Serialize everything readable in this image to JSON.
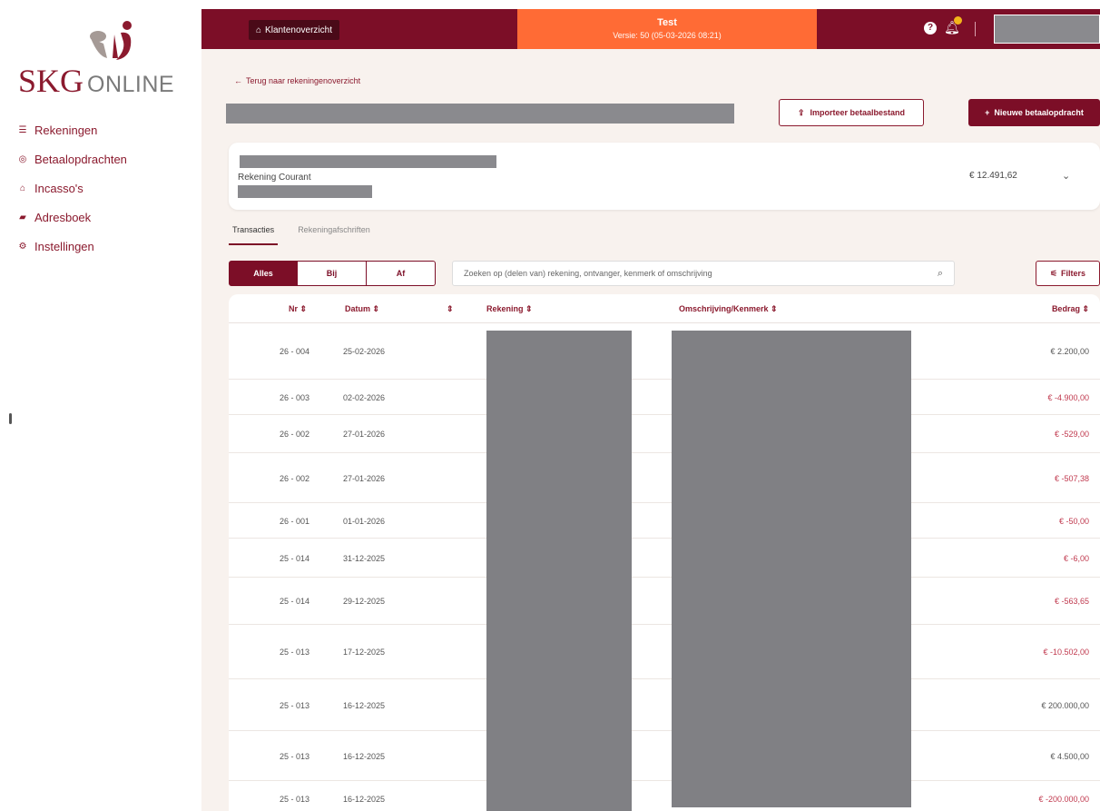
{
  "brand": {
    "name": "SKG",
    "suffix": "ONLINE",
    "color": "#8b1a2e"
  },
  "sidebar": {
    "items": [
      {
        "label": "Rekeningen",
        "icon": "list-icon"
      },
      {
        "label": "Betaalopdrachten",
        "icon": "circle-icon"
      },
      {
        "label": "Incasso's",
        "icon": "inbox-icon"
      },
      {
        "label": "Adresboek",
        "icon": "book-icon"
      },
      {
        "label": "Instellingen",
        "icon": "gears-icon"
      }
    ]
  },
  "topbar": {
    "klanten_label": "Klantenoverzicht",
    "env_title": "Test",
    "env_version": "Versie: 50 (05-03-2026 08:21)",
    "bg_color": "#7c0e27",
    "env_color": "#ff6b35"
  },
  "page": {
    "back_label": "Terug naar rekeningenoverzicht",
    "import_label": "Importeer betaalbestand",
    "new_label": "Nieuwe betaalopdracht"
  },
  "account": {
    "type": "Rekening Courant",
    "balance": "€ 12.491,62"
  },
  "tabs": [
    "Transacties",
    "Rekeningafschriften"
  ],
  "filters": {
    "options": [
      "Alles",
      "Bij",
      "Af"
    ],
    "search_placeholder": "Zoeken op (delen van) rekening, ontvanger, kenmerk of omschrijving",
    "filters_label": "Filters"
  },
  "table": {
    "headers": {
      "nr": "Nr ⇕",
      "datum": "Datum ⇕",
      "extra": "⇕",
      "rekening": "Rekening ⇕",
      "omschrijving": "Omschrijving/Kenmerk ⇕",
      "bedrag": "Bedrag ⇕"
    },
    "rows": [
      {
        "nr": "26 - 004",
        "datum": "25-02-2026",
        "bedrag": "€ 2.200,00"
      },
      {
        "nr": "26 - 003",
        "datum": "02-02-2026",
        "bedrag": "€ -4.900,00"
      },
      {
        "nr": "26 - 002",
        "datum": "27-01-2026",
        "bedrag": "€ -529,00"
      },
      {
        "nr": "26 - 002",
        "datum": "27-01-2026",
        "bedrag": "€ -507,38"
      },
      {
        "nr": "26 - 001",
        "datum": "01-01-2026",
        "bedrag": "€ -50,00"
      },
      {
        "nr": "25 - 014",
        "datum": "31-12-2025",
        "bedrag": "€ -6,00"
      },
      {
        "nr": "25 - 014",
        "datum": "29-12-2025",
        "bedrag": "€ -563,65"
      },
      {
        "nr": "25 - 013",
        "datum": "17-12-2025",
        "bedrag": "€ -10.502,00"
      },
      {
        "nr": "25 - 013",
        "datum": "16-12-2025",
        "bedrag": "€ 200.000,00"
      },
      {
        "nr": "25 - 013",
        "datum": "16-12-2025",
        "bedrag": "€ 4.500,00"
      },
      {
        "nr": "25 - 013",
        "datum": "16-12-2025",
        "bedrag": "€ -200.000,00"
      }
    ],
    "negative_color": "#c0394e"
  }
}
